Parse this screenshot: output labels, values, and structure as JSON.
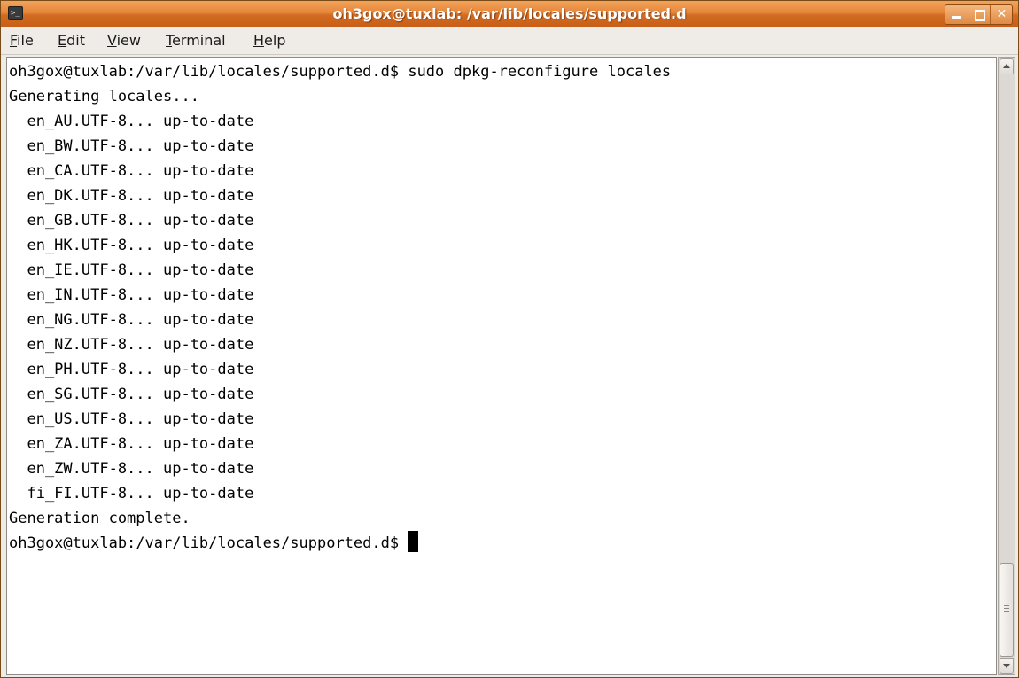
{
  "window": {
    "title": "oh3gox@tuxlab: /var/lib/locales/supported.d",
    "app_icon": "terminal-icon",
    "controls": {
      "minimize": "minimize-icon",
      "maximize": "maximize-icon",
      "close_glyph": "✕"
    }
  },
  "menu": {
    "items": [
      {
        "label": "File",
        "mnemonic": "F"
      },
      {
        "label": "Edit",
        "mnemonic": "E"
      },
      {
        "label": "View",
        "mnemonic": "V"
      },
      {
        "label": "Terminal",
        "mnemonic": "T"
      },
      {
        "label": "Help",
        "mnemonic": "H"
      }
    ]
  },
  "terminal": {
    "lines": [
      "oh3gox@tuxlab:/var/lib/locales/supported.d$ sudo dpkg-reconfigure locales",
      "Generating locales...",
      "  en_AU.UTF-8... up-to-date",
      "  en_BW.UTF-8... up-to-date",
      "  en_CA.UTF-8... up-to-date",
      "  en_DK.UTF-8... up-to-date",
      "  en_GB.UTF-8... up-to-date",
      "  en_HK.UTF-8... up-to-date",
      "  en_IE.UTF-8... up-to-date",
      "  en_IN.UTF-8... up-to-date",
      "  en_NG.UTF-8... up-to-date",
      "  en_NZ.UTF-8... up-to-date",
      "  en_PH.UTF-8... up-to-date",
      "  en_SG.UTF-8... up-to-date",
      "  en_US.UTF-8... up-to-date",
      "  en_ZA.UTF-8... up-to-date",
      "  en_ZW.UTF-8... up-to-date",
      "  fi_FI.UTF-8... up-to-date",
      "Generation complete."
    ],
    "prompt": "oh3gox@tuxlab:/var/lib/locales/supported.d$ "
  },
  "colors": {
    "titlebar": "#e7863a",
    "terminal_bg": "#ffffff",
    "terminal_fg": "#000000",
    "window_bg": "#efebe7"
  },
  "scrollbar": {
    "up_icon": "chevron-up-icon",
    "down_icon": "chevron-down-icon"
  }
}
